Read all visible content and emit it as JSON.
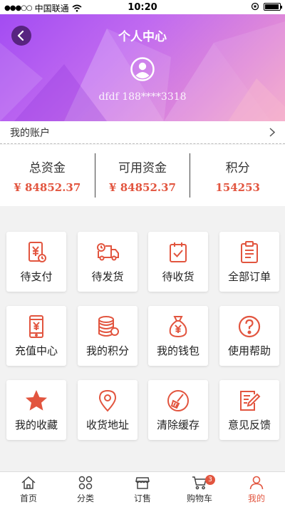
{
  "status": {
    "carrier": "中国联通",
    "signal_dots": "●●●○○",
    "time": "10:20"
  },
  "header": {
    "title": "个人中心",
    "username": "dfdf 188****3318"
  },
  "account": {
    "label": "我的账户"
  },
  "funds": [
    {
      "title": "总资金",
      "value": "¥ 84852.37"
    },
    {
      "title": "可用资金",
      "value": "¥ 84852.37"
    },
    {
      "title": "积分",
      "value": "154253"
    }
  ],
  "menu": [
    {
      "label": "待支付",
      "icon": "pending-payment-icon"
    },
    {
      "label": "待发货",
      "icon": "delivery-truck-icon"
    },
    {
      "label": "待收货",
      "icon": "receive-check-icon"
    },
    {
      "label": "全部订单",
      "icon": "clipboard-icon"
    },
    {
      "label": "充值中心",
      "icon": "phone-recharge-icon"
    },
    {
      "label": "我的积分",
      "icon": "coins-icon"
    },
    {
      "label": "我的钱包",
      "icon": "money-bag-icon"
    },
    {
      "label": "使用帮助",
      "icon": "help-icon"
    },
    {
      "label": "我的收藏",
      "icon": "star-icon"
    },
    {
      "label": "收货地址",
      "icon": "location-pin-icon"
    },
    {
      "label": "清除缓存",
      "icon": "broom-icon"
    },
    {
      "label": "意见反馈",
      "icon": "feedback-edit-icon"
    }
  ],
  "tabs": [
    {
      "label": "首页",
      "icon": "home-icon"
    },
    {
      "label": "分类",
      "icon": "category-grid-icon"
    },
    {
      "label": "订售",
      "icon": "store-icon"
    },
    {
      "label": "购物车",
      "icon": "cart-icon",
      "badge": "3"
    },
    {
      "label": "我的",
      "icon": "user-icon"
    }
  ],
  "colors": {
    "accent": "#e2553f",
    "header_start": "#a34cf2",
    "header_end": "#f4a6c6"
  }
}
